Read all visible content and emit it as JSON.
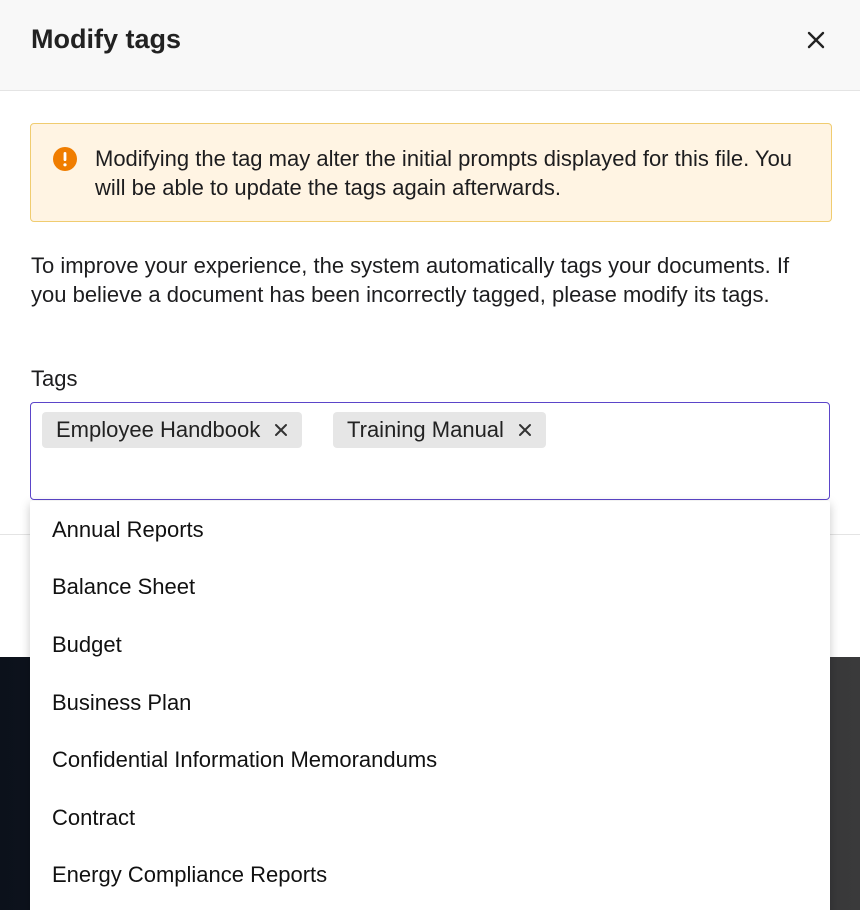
{
  "modal": {
    "title": "Modify tags"
  },
  "warning": {
    "text": "Modifying the tag may alter the initial prompts displayed for this file. You will be able to update the tags again afterwards.",
    "color": "#f07d00"
  },
  "description": "To improve your experience, the system automatically tags your documents. If you believe a document has been incorrectly tagged, please modify its tags.",
  "tags": {
    "label": "Tags",
    "selected": [
      "Employee Handbook",
      "Training Manual"
    ],
    "options": [
      "Annual Reports",
      "Balance Sheet",
      "Budget",
      "Business Plan",
      "Confidential Information Memorandums",
      "Contract",
      "Energy Compliance Reports"
    ]
  },
  "colors": {
    "accent": "#5b45c9",
    "warning_bg": "#fff4e3",
    "warning_border": "#f0cc70",
    "chip_bg": "#e6e6e6"
  }
}
